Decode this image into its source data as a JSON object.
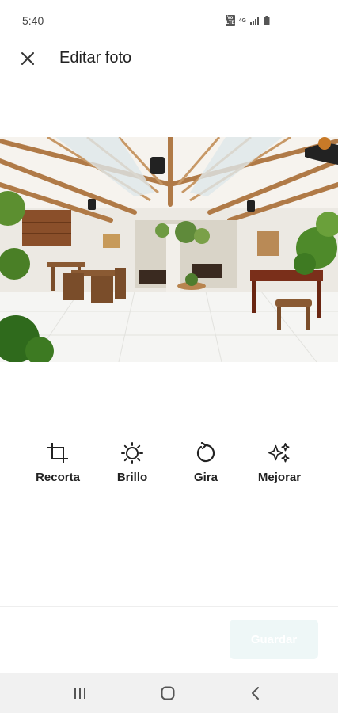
{
  "status_bar": {
    "time": "5:40",
    "volte_label": "Vo LTE",
    "network_label": "4G"
  },
  "header": {
    "title": "Editar foto",
    "close_icon": "close-icon"
  },
  "photo": {
    "subject": "restaurant-courtyard-photo"
  },
  "tools": [
    {
      "label": "Recorta",
      "icon": "crop-icon"
    },
    {
      "label": "Brillo",
      "icon": "brightness-icon"
    },
    {
      "label": "Gira",
      "icon": "rotate-icon"
    },
    {
      "label": "Mejorar",
      "icon": "sparkles-icon"
    }
  ],
  "footer": {
    "save_label": "Guardar"
  },
  "colors": {
    "accent_disabled_bg": "#eef7f7",
    "text": "#222222"
  }
}
